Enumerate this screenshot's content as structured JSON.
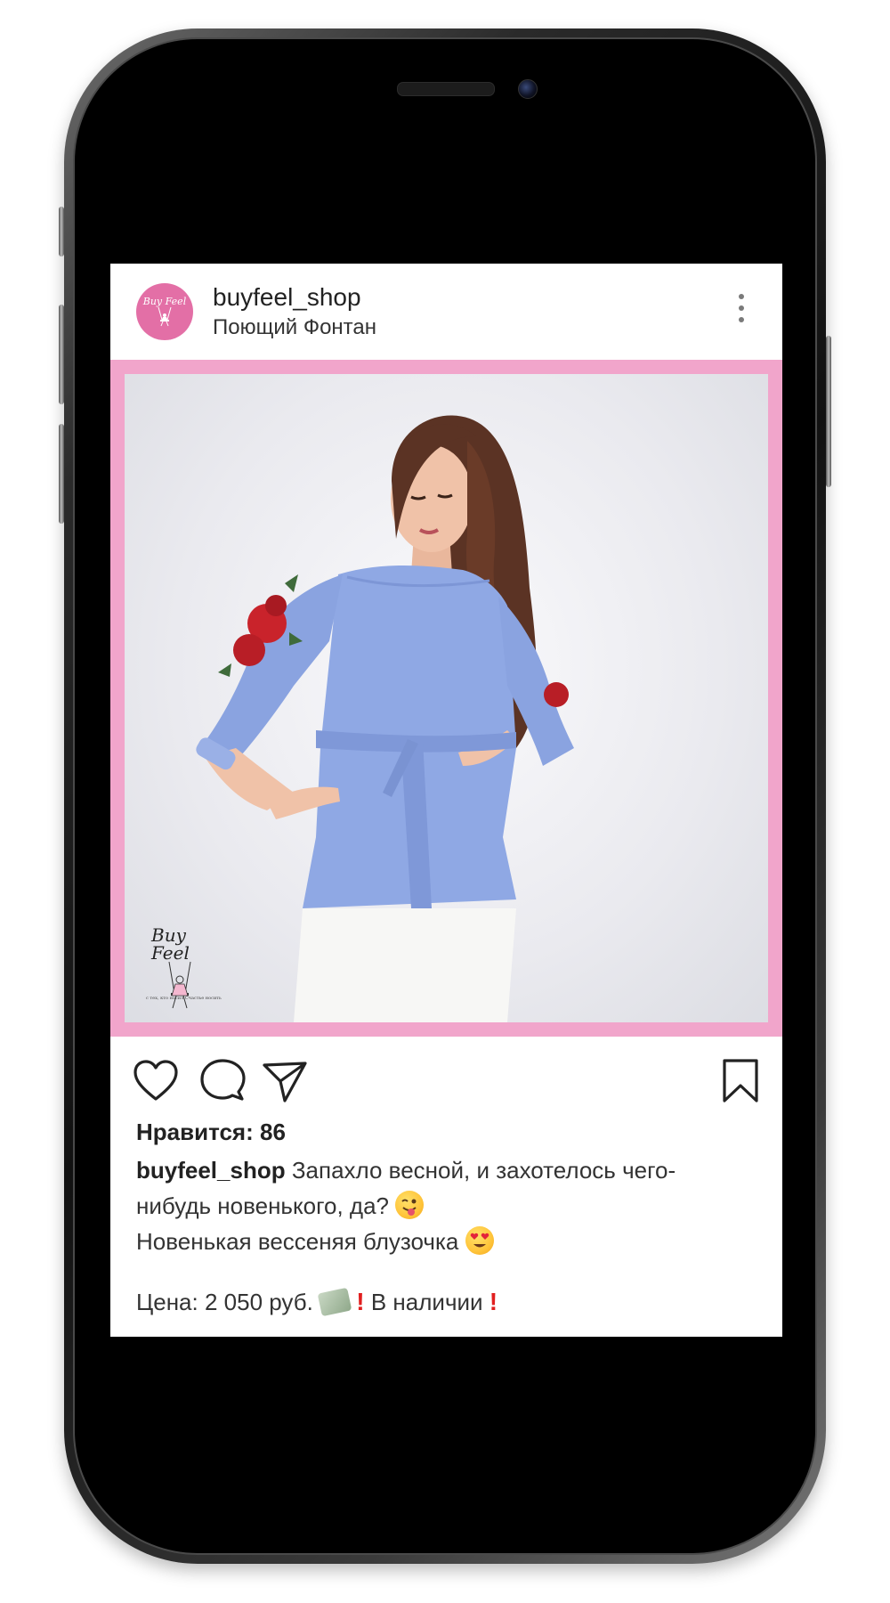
{
  "post": {
    "username": "buyfeel_shop",
    "location": "Поющий Фонтан",
    "avatar_text": "Buy Feel",
    "watermark_brand": "Buy Feel",
    "watermark_tagline": "с тех, кто носил Счастье носить",
    "likes": "Нравится: 86",
    "caption_user": "buyfeel_shop",
    "caption_line1": "Запахло весной, и захотелось чего-",
    "caption_line2": "нибудь новенького, да?",
    "caption_line3": "Новенькая вессеняя блузочка",
    "price_text": "Цена: 2 050 руб.",
    "availability_text": "В наличии"
  },
  "icons": {
    "like": "heart-icon",
    "comment": "comment-icon",
    "share": "send-icon",
    "save": "bookmark-icon",
    "more": "more-vertical-icon",
    "emoji_wink": "winking-tongue-emoji",
    "emoji_love": "heart-eyes-emoji",
    "emoji_money": "money-wings-emoji",
    "emoji_excl": "red-exclamation-emoji"
  },
  "colors": {
    "frame_pink": "#f1a5cb",
    "avatar_pink": "#e36fa6",
    "text_dark": "#222222"
  }
}
